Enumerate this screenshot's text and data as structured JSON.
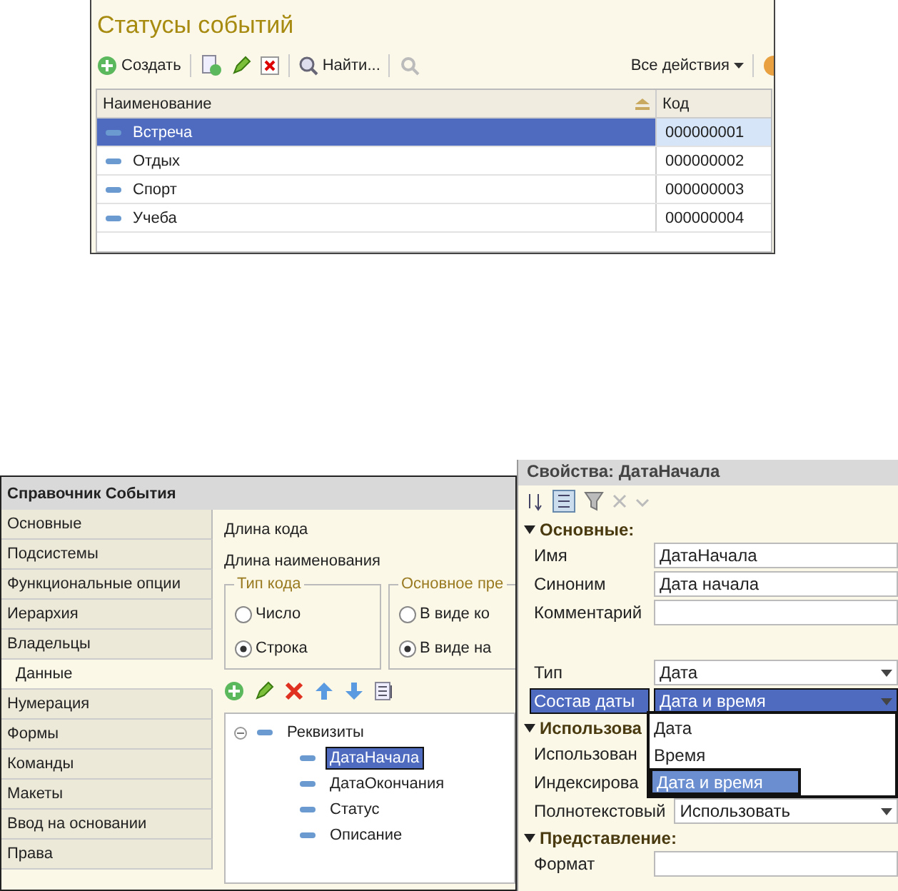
{
  "statuses_window": {
    "title": "Статусы событий",
    "toolbar": {
      "create": "Создать",
      "find": "Найти...",
      "all_actions": "Все действия"
    },
    "table": {
      "columns": [
        "Наименование",
        "Код"
      ],
      "rows": [
        {
          "name": "Встреча",
          "code": "000000001",
          "selected": true
        },
        {
          "name": "Отдых",
          "code": "000000002",
          "selected": false
        },
        {
          "name": "Спорт",
          "code": "000000003",
          "selected": false
        },
        {
          "name": "Учеба",
          "code": "000000004",
          "selected": false
        }
      ]
    }
  },
  "catalog_window": {
    "title": "Справочник События",
    "sidebar": {
      "items": [
        {
          "label": "Основные",
          "selected": false
        },
        {
          "label": "Подсистемы",
          "selected": false
        },
        {
          "label": "Функциональные опции",
          "selected": false
        },
        {
          "label": "Иерархия",
          "selected": false
        },
        {
          "label": "Владельцы",
          "selected": false
        },
        {
          "label": "Данные",
          "selected": true
        },
        {
          "label": "Нумерация",
          "selected": false
        },
        {
          "label": "Формы",
          "selected": false
        },
        {
          "label": "Команды",
          "selected": false
        },
        {
          "label": "Макеты",
          "selected": false
        },
        {
          "label": "Ввод на основании",
          "selected": false
        },
        {
          "label": "Права",
          "selected": false
        }
      ]
    },
    "fields": [
      "Длина кода",
      "Длина наименования"
    ],
    "groups": [
      {
        "title": "Тип кода",
        "options": [
          {
            "label": "Число",
            "selected": false
          },
          {
            "label": "Строка",
            "selected": true
          }
        ]
      },
      {
        "title": "Основное пре",
        "options": [
          {
            "label": "В виде ко",
            "selected": false
          },
          {
            "label": "В виде на",
            "selected": true
          }
        ]
      }
    ],
    "tree": [
      {
        "label": "Реквизиты",
        "expanded": true,
        "selected": false,
        "children": [
          {
            "label": "ДатаНачала",
            "selected": true
          },
          {
            "label": "ДатаОкончания",
            "selected": false
          },
          {
            "label": "Статус",
            "selected": false
          },
          {
            "label": "Описание",
            "selected": false
          }
        ]
      }
    ]
  },
  "properties": {
    "title": "Свойства: ДатаНачала",
    "sections": [
      {
        "title": "Основные:",
        "expanded": true,
        "rows": [
          {
            "label": "Имя",
            "value": "ДатаНачала",
            "selected": false,
            "kind": "text"
          },
          {
            "label": "Синоним",
            "value": "Дата начала",
            "selected": false,
            "kind": "text"
          },
          {
            "label": "Комментарий",
            "value": "",
            "selected": false,
            "kind": "text"
          },
          {
            "label": "Тип",
            "value": "Дата",
            "selected": false,
            "kind": "combo"
          },
          {
            "label": "Состав даты",
            "value": "Дата и время",
            "selected": true,
            "kind": "combo"
          }
        ]
      },
      {
        "title": "Использова",
        "expanded": true,
        "rows": [
          {
            "label": "Использован",
            "value": "",
            "selected": false,
            "kind": "plain"
          },
          {
            "label": "Индексирова",
            "value": "",
            "selected": false,
            "kind": "plain"
          },
          {
            "label": "Полнотекстовый",
            "value": "Использовать",
            "selected": false,
            "kind": "combo"
          }
        ]
      },
      {
        "title": "Представление:",
        "expanded": true,
        "rows": [
          {
            "label": "Формат",
            "value": "",
            "selected": false,
            "kind": "text"
          }
        ]
      }
    ],
    "dropdown": [
      {
        "label": "Дата",
        "selected": false
      },
      {
        "label": "Время",
        "selected": false
      },
      {
        "label": "Дата и время",
        "selected": true
      }
    ]
  }
}
